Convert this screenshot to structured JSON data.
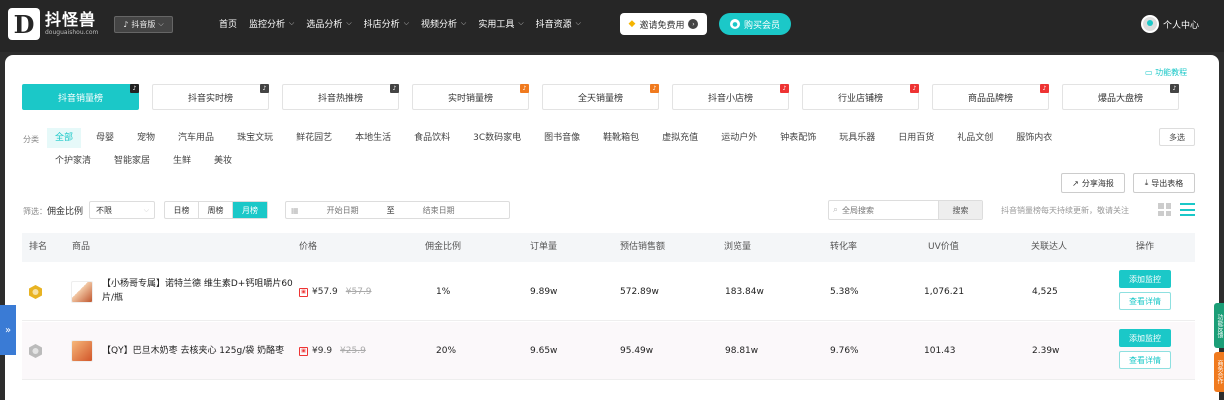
{
  "header": {
    "logo_mark": "D",
    "logo_cn": "抖怪兽",
    "logo_en": "douguaishou.com",
    "version_switch": "抖音版",
    "menu": [
      {
        "label": "首页",
        "dropdown": false
      },
      {
        "label": "监控分析",
        "dropdown": true
      },
      {
        "label": "选品分析",
        "dropdown": true
      },
      {
        "label": "抖店分析",
        "dropdown": true
      },
      {
        "label": "视频分析",
        "dropdown": true
      },
      {
        "label": "实用工具",
        "dropdown": true
      },
      {
        "label": "抖音资源",
        "dropdown": true
      }
    ],
    "invite_label": "邀请免费用",
    "buy_label": "购买会员",
    "user_label": "个人中心"
  },
  "help_link": "功能教程",
  "tabs": [
    {
      "label": "抖音销量榜",
      "badge_color": "#222",
      "active": true
    },
    {
      "label": "抖音实时榜",
      "badge_color": "#444",
      "active": false
    },
    {
      "label": "抖音热推榜",
      "badge_color": "#444",
      "active": false
    },
    {
      "label": "实时销量榜",
      "badge_color": "#f07a1e",
      "active": false
    },
    {
      "label": "全天销量榜",
      "badge_color": "#f07a1e",
      "active": false
    },
    {
      "label": "抖音小店榜",
      "badge_color": "#e33",
      "active": false
    },
    {
      "label": "行业店铺榜",
      "badge_color": "#e33",
      "active": false
    },
    {
      "label": "商品品牌榜",
      "badge_color": "#e33",
      "active": false
    },
    {
      "label": "爆品大盘榜",
      "badge_color": "#444",
      "active": false
    }
  ],
  "categories": {
    "label": "分类",
    "items": [
      "全部",
      "母婴",
      "宠物",
      "汽车用品",
      "珠宝文玩",
      "鲜花园艺",
      "本地生活",
      "食品饮料",
      "3C数码家电",
      "图书音像",
      "鞋靴箱包",
      "虚拟充值",
      "运动户外",
      "钟表配饰",
      "玩具乐器",
      "日用百货",
      "礼品文创",
      "服饰内衣",
      "个护家清",
      "智能家居",
      "生鲜",
      "美妆"
    ],
    "active_index": 0,
    "more_label": "多选"
  },
  "actions": {
    "share_label": "分享海报",
    "export_label": "导出表格"
  },
  "filters": {
    "label": "筛选：",
    "commission_label": "佣金比例",
    "commission_value": "不限",
    "periods": [
      "日榜",
      "周榜",
      "月榜"
    ],
    "active_period": 2,
    "start_placeholder": "开始日期",
    "range_sep": "至",
    "end_placeholder": "结束日期",
    "search_placeholder": "全局搜索",
    "search_button": "搜索",
    "update_note": "抖音销量榜每天持续更新，敬请关注"
  },
  "table": {
    "columns": [
      "排名",
      "商品",
      "价格",
      "佣金比例",
      "订单量",
      "预估销售额",
      "浏览量",
      "转化率",
      "UV价值",
      "关联达人",
      "操作"
    ],
    "rows": [
      {
        "rank_medal": "#e8b323",
        "name": "【小杨哥专属】诺特兰德 维生素D+钙咀嚼片60片/瓶",
        "price": "¥57.9",
        "orig_price": "¥57.9",
        "commission": "1%",
        "orders": "9.89w",
        "sales": "572.89w",
        "views": "183.84w",
        "conversion": "5.38%",
        "uv_value": "1,076.21",
        "influencers": "4,525"
      },
      {
        "rank_medal": "#bbbbbb",
        "name": "【QY】巴旦木奶枣 去核夹心 125g/袋 奶酪枣",
        "price": "¥9.9",
        "orig_price": "¥25.9",
        "commission": "20%",
        "orders": "9.65w",
        "sales": "95.49w",
        "views": "98.81w",
        "conversion": "9.76%",
        "uv_value": "101.43",
        "influencers": "2.39w"
      }
    ],
    "monitor_label": "添加监控",
    "detail_label": "查看详情"
  },
  "side_tab": "»",
  "float_right": [
    "功能反馈",
    "商务合作"
  ]
}
